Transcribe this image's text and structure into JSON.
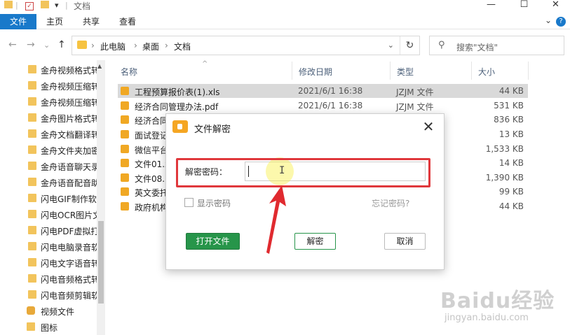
{
  "window": {
    "title": "文档",
    "minimize": "—",
    "maximize": "☐",
    "close": "✕"
  },
  "ribbon": {
    "tabs": [
      "文件",
      "主页",
      "共享",
      "查看"
    ],
    "help": "?",
    "collapse": "⌄"
  },
  "nav": {
    "back": "←",
    "forward": "→",
    "recent": "⌄",
    "up": "↑",
    "path": [
      "此电脑",
      "桌面",
      "文档"
    ],
    "refresh": "↻",
    "search_placeholder": "搜索\"文档\""
  },
  "sidebar": {
    "items": [
      {
        "label": "金舟视频格式转"
      },
      {
        "label": "金舟视频压缩转"
      },
      {
        "label": "金舟视频压缩转"
      },
      {
        "label": "金舟图片格式转"
      },
      {
        "label": "金舟文档翻译转"
      },
      {
        "label": "金舟文件夹加密"
      },
      {
        "label": "金舟语音聊天录"
      },
      {
        "label": "金舟语音配音助"
      },
      {
        "label": "闪电GIF制作软"
      },
      {
        "label": "闪电OCR图片文"
      },
      {
        "label": "闪电PDF虚拟打"
      },
      {
        "label": "闪电电脑录音软"
      },
      {
        "label": "闪电文字语音转"
      },
      {
        "label": "闪电音频格式转"
      },
      {
        "label": "闪电音频剪辑软"
      },
      {
        "label": "视频文件"
      },
      {
        "label": "图标"
      }
    ]
  },
  "columns": {
    "name": "名称",
    "date": "修改日期",
    "type": "类型",
    "size": "大小"
  },
  "files": [
    {
      "name": "工程预算报价表(1).xls",
      "date": "2021/6/1 16:38",
      "type": "JZJM 文件",
      "size": "44 KB",
      "selected": true
    },
    {
      "name": "经济合同管理办法.pdf",
      "date": "2021/6/1 16:38",
      "type": "JZJM 文件",
      "size": "531 KB"
    },
    {
      "name": "经济合同",
      "date": "",
      "type": "",
      "size": "836 KB"
    },
    {
      "name": "面试登记",
      "date": "",
      "type": "",
      "size": "13 KB"
    },
    {
      "name": "微信平台",
      "date": "",
      "type": "",
      "size": "1,533 KB"
    },
    {
      "name": "文件01.x",
      "date": "",
      "type": "",
      "size": "14 KB"
    },
    {
      "name": "文件08.p",
      "date": "",
      "type": "",
      "size": "1,390 KB"
    },
    {
      "name": "英文委托",
      "date": "",
      "type": "",
      "size": "99 KB"
    },
    {
      "name": "政府机构",
      "date": "",
      "type": "",
      "size": "44 KB"
    }
  ],
  "dialog": {
    "title": "文件解密",
    "close": "✕",
    "password_label": "解密密码：",
    "password_value": "",
    "show_password": "显示密码",
    "forgot": "忘记密码?",
    "btn_open": "打开文件",
    "btn_decrypt": "解密",
    "btn_cancel": "取消",
    "cursor": "I"
  },
  "watermark": {
    "logo": "Baidu经验",
    "sub": "jingyan.baidu.com"
  },
  "colors": {
    "accent": "#1979ca",
    "green": "#27954a",
    "highlight_red": "#e0383c"
  }
}
